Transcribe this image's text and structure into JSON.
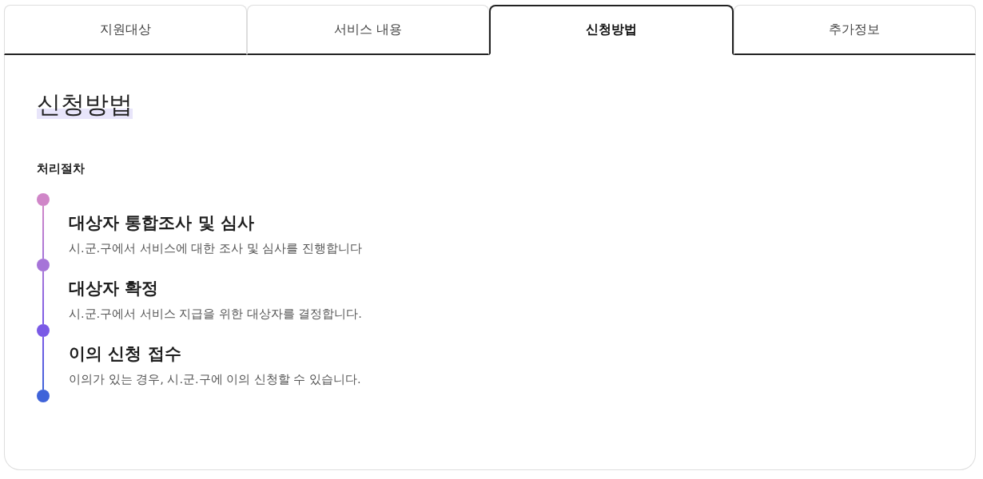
{
  "tabs": [
    {
      "label": "지원대상",
      "selected": false
    },
    {
      "label": "서비스 내용",
      "selected": false
    },
    {
      "label": "신청방법",
      "selected": true
    },
    {
      "label": "추가정보",
      "selected": false
    }
  ],
  "section": {
    "title": "신청방법",
    "subtitle": "처리절차",
    "timeline": {
      "markers": [
        {
          "color": "#d086c8"
        },
        {
          "color": "#a674d8"
        },
        {
          "color": "#7a5ae6"
        },
        {
          "color": "#3f63d9"
        }
      ],
      "steps": [
        {
          "title": "대상자 통합조사 및 심사",
          "description": "시.군.구에서 서비스에 대한 조사 및 심사를 진행합니다"
        },
        {
          "title": "대상자 확정",
          "description": "시.군.구에서 서비스 지급을 위한 대상자를 결정합니다."
        },
        {
          "title": "이의 신청 접수",
          "description": "이의가 있는 경우, 시.군.구에 이의 신청할 수 있습니다."
        }
      ]
    }
  }
}
